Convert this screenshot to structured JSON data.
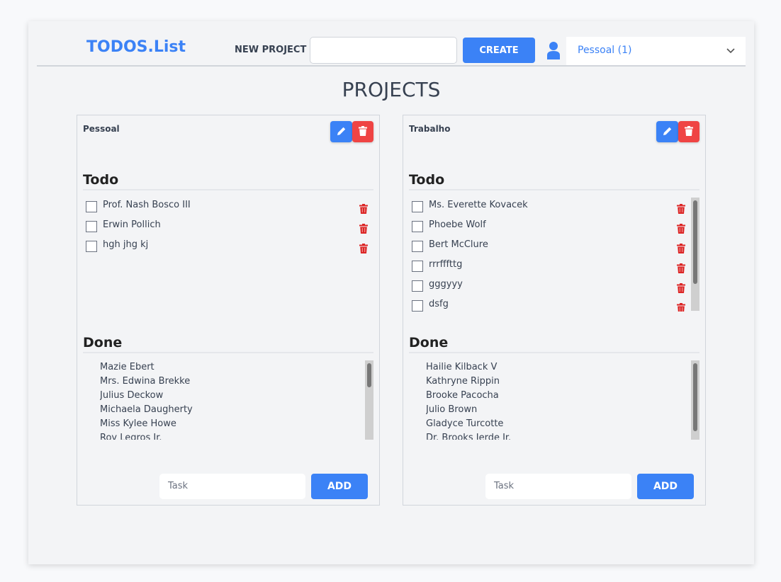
{
  "header": {
    "logo": "TODOS.List",
    "new_project_label": "NEW PROJECT",
    "new_project_value": "",
    "create_label": "CREATE",
    "user_icon": "user-icon",
    "project_select": "Pessoal (1)"
  },
  "page_title": "PROJECTS",
  "colors": {
    "primary": "#3b82f6",
    "danger": "#ef4444"
  },
  "projects": [
    {
      "name": "Pessoal",
      "todo_heading": "Todo",
      "done_heading": "Done",
      "todo": [
        "Prof. Nash Bosco III",
        "Erwin Pollich",
        "hgh jhg kj"
      ],
      "done": [
        "Mazie Ebert",
        "Mrs. Edwina Brekke",
        "Julius Deckow",
        "Michaela Daugherty",
        "Miss Kylee Howe",
        "Roy Legros Jr."
      ],
      "task_placeholder": "Task",
      "add_label": "ADD"
    },
    {
      "name": "Trabalho",
      "todo_heading": "Todo",
      "done_heading": "Done",
      "todo": [
        "Ms. Everette Kovacek",
        "Phoebe Wolf",
        "Bert McClure",
        "rrrfffttg",
        "gggyyy",
        "dsfg"
      ],
      "done": [
        "Hailie Kilback V",
        "Kathryne Rippin",
        "Brooke Pacocha",
        "Julio Brown",
        "Gladyce Turcotte",
        "Dr. Brooks Jerde Jr."
      ],
      "task_placeholder": "Task",
      "add_label": "ADD"
    }
  ]
}
